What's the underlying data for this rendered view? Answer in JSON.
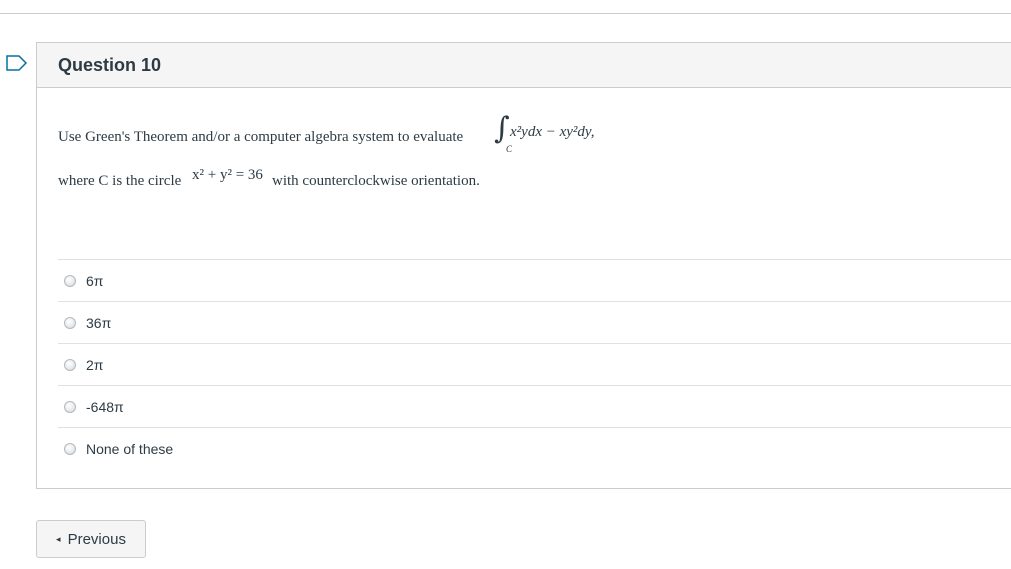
{
  "question": {
    "title": "Question 10",
    "text_line1": "Use Green's Theorem and/or a computer algebra system to evaluate",
    "integral_sign": "∫",
    "integral_subscript": "C",
    "integral_expression": "x²ydx − xy²dy,",
    "text_line2_start": "where C is the circle",
    "circle_equation": "x² + y² = 36",
    "text_line2_end": "with counterclockwise orientation."
  },
  "answers": [
    {
      "label": "6π"
    },
    {
      "label": "36π"
    },
    {
      "label": "2π"
    },
    {
      "label": "-648π"
    },
    {
      "label": "None of these"
    }
  ],
  "navigation": {
    "previous_caret": "◂",
    "previous_label": "Previous"
  },
  "icons": {
    "flag": "flag-icon",
    "radio": "radio-icon",
    "caret": "caret-left-icon"
  },
  "colors": {
    "text": "#2d3b45",
    "border": "#c7cdd1",
    "header_bg": "#f5f5f5",
    "flag": "#0770a3"
  }
}
